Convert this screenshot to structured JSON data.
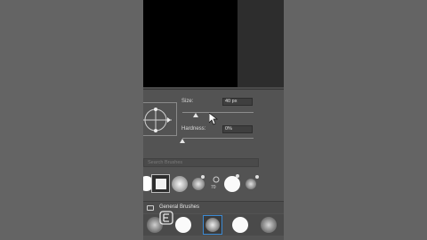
{
  "panel": {
    "size_label": "Size:",
    "size_value": "40 px",
    "hardness_label": "Hardness:",
    "hardness_value": "0%",
    "search_placeholder": "Search Brushes",
    "brush_number": "70",
    "group_label": "General Brushes"
  },
  "sliders": {
    "size_fraction": 0.19,
    "hardness_fraction": 0.0
  },
  "colors": {
    "canvas": "#000000",
    "panel": "#535353",
    "selection_accent": "#3b8ad4"
  },
  "icons": [
    "angle-roundness-widget-icon",
    "folder-icon",
    "mouse-cursor-icon",
    "watermark-logo-icon"
  ]
}
